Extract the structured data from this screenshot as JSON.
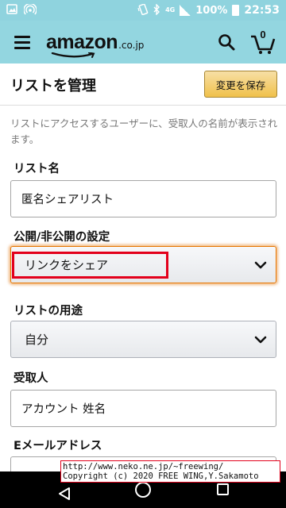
{
  "status_bar": {
    "battery_percent": "100%",
    "time": "22:53",
    "network": "4G",
    "icons": [
      "image-icon",
      "hotspot-icon",
      "vibrate-icon",
      "bluetooth-icon",
      "signal-icon",
      "battery-icon"
    ]
  },
  "header": {
    "logo_text": "amazon",
    "logo_suffix": ".co.jp",
    "cart_count": "0",
    "icons": [
      "menu-icon",
      "search-icon",
      "cart-icon"
    ]
  },
  "page": {
    "title": "リストを管理",
    "save_button": "変更を保存",
    "description": "リストにアクセスするユーザーに、受取人の名前が表示されます。"
  },
  "form": {
    "list_name_label": "リスト名",
    "list_name_value": "匿名シェアリスト",
    "privacy_label": "公開/非公開の設定",
    "privacy_value": "リンクをシェア",
    "purpose_label": "リストの用途",
    "purpose_value": "自分",
    "recipient_label": "受取人",
    "recipient_value": "アカウント 姓名",
    "email_label": "Eメールアドレス"
  },
  "overlay": {
    "url": "http://www.neko.ne.jp/~freewing/",
    "copyright": "Copyright (c) 2020 FREE WING,Y.Sakamoto"
  },
  "colors": {
    "header_bg": "#93d6e0",
    "save_button": "#f0c14b",
    "focus_outline": "#e77600",
    "highlight": "#e3001b"
  }
}
